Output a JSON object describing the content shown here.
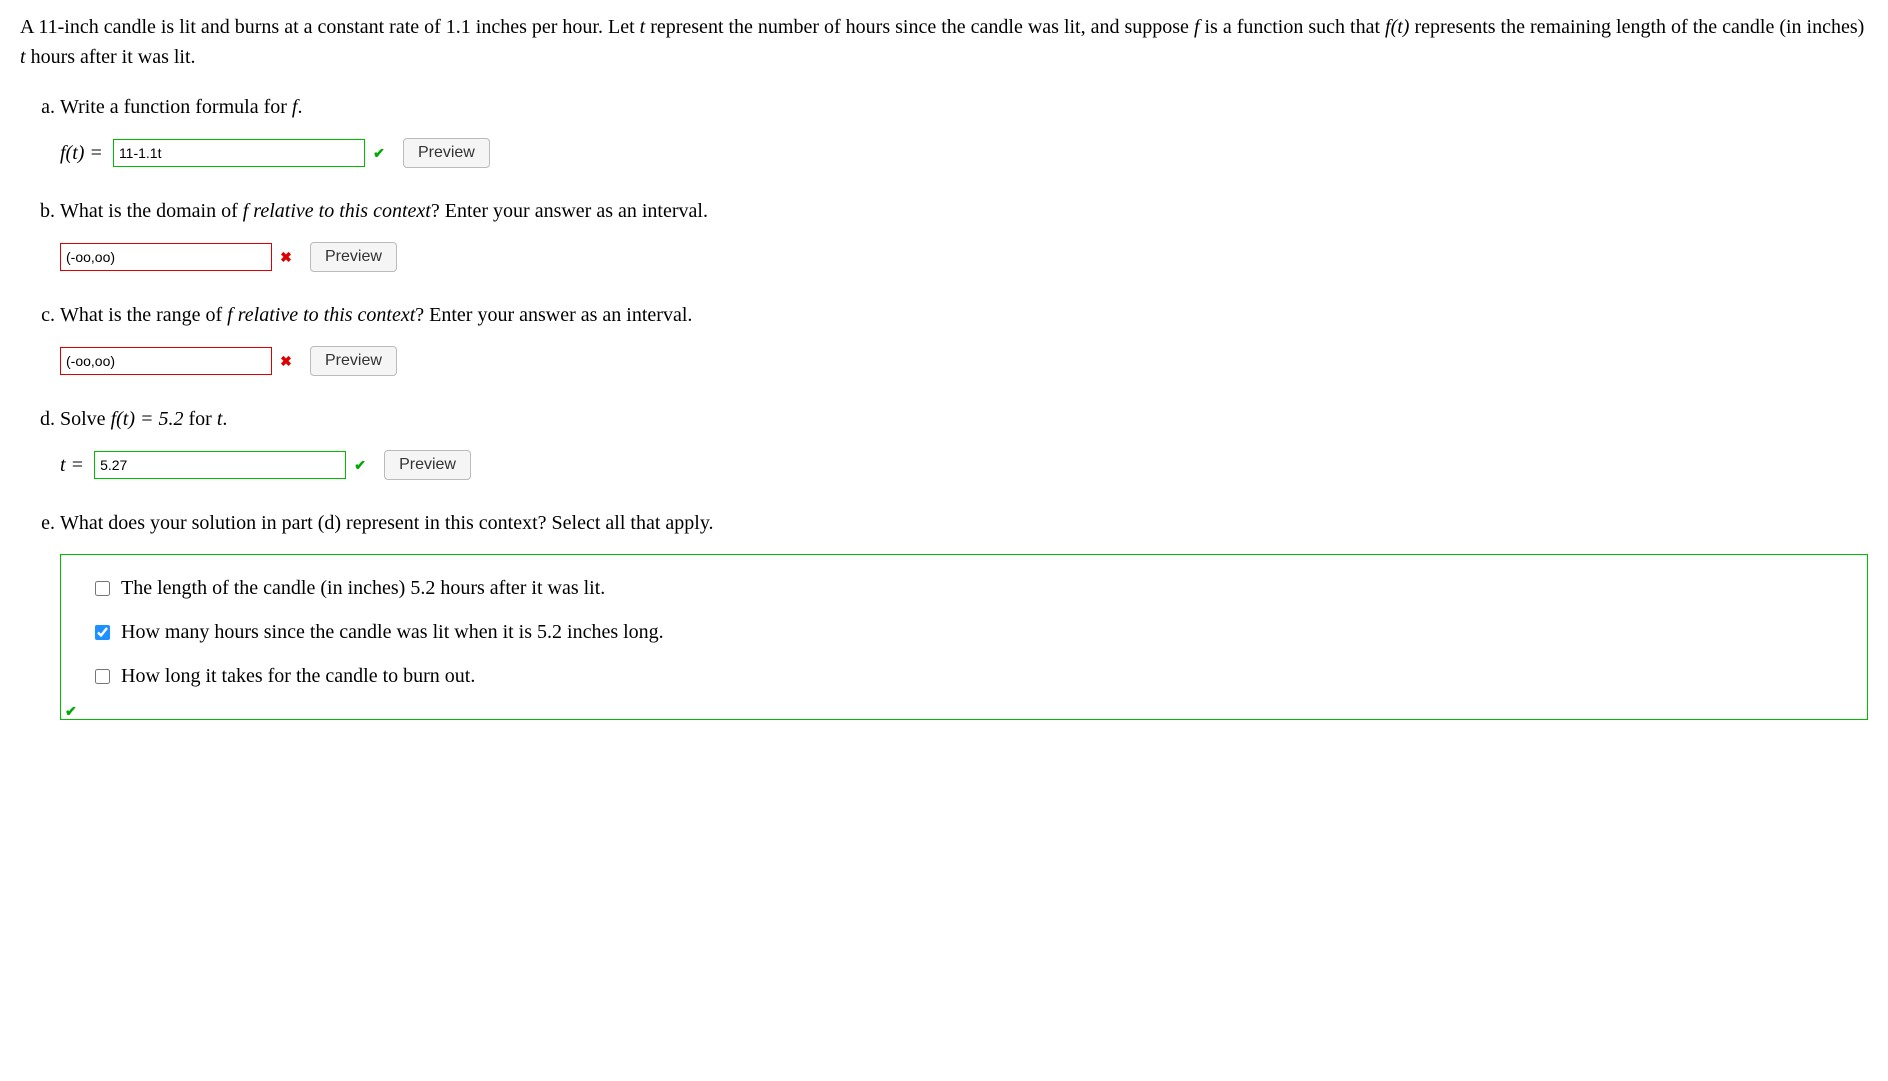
{
  "problem": {
    "text1": "A 11-inch candle is lit and burns at a constant rate of 1.1 inches per hour. Let ",
    "var_t": "t",
    "text2": " represent the number of hours since the candle was lit, and suppose ",
    "var_f": "f",
    "text3": " is a function such that ",
    "func_ft": "f(t)",
    "text4": " represents the remaining length of the candle (in inches) ",
    "var_t2": "t",
    "text5": " hours after it was lit."
  },
  "parts": {
    "a": {
      "question1": "Write a function formula for ",
      "question_var": "f",
      "question2": ".",
      "prefix": "f(t) = ",
      "input_value": "11-1.1t",
      "status": "correct"
    },
    "b": {
      "question1": "What is the domain of ",
      "question_var": "f",
      "question_italic": " relative to this context",
      "question2": "? Enter your answer as an interval.",
      "input_value": "(-oo,oo)",
      "status": "incorrect"
    },
    "c": {
      "question1": "What is the range of ",
      "question_var": "f",
      "question_italic": " relative to this context",
      "question2": "? Enter your answer as an interval.",
      "input_value": "(-oo,oo)",
      "status": "incorrect"
    },
    "d": {
      "question1": "Solve ",
      "question_eq": "f(t) = 5.2",
      "question2": " for ",
      "question_var": "t",
      "question3": ".",
      "prefix": "t = ",
      "input_value": "5.27",
      "status": "correct"
    },
    "e": {
      "question": "What does your solution in part (d) represent in this context? Select all that apply.",
      "options": [
        {
          "label": "The length of the candle (in inches) 5.2 hours after it was lit.",
          "checked": false
        },
        {
          "label": "How many hours since the candle was lit when it is 5.2 inches long.",
          "checked": true
        },
        {
          "label": "How long it takes for the candle to burn out.",
          "checked": false
        }
      ],
      "status": "correct"
    }
  },
  "buttons": {
    "preview": "Preview"
  },
  "marks": {
    "correct": "✔",
    "incorrect": "✖"
  }
}
